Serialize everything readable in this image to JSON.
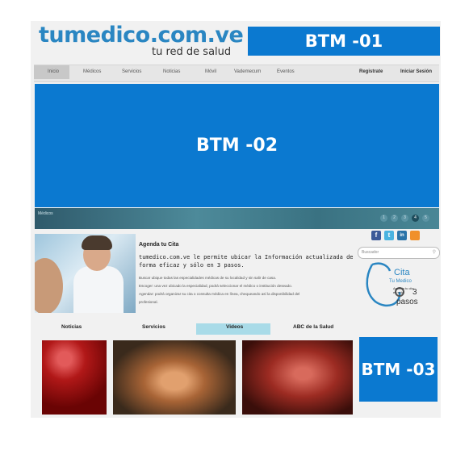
{
  "header": {
    "logo_main": "tumedico.com.ve",
    "logo_tagline": "tu red de salud",
    "banner_top": "BTM -01"
  },
  "nav": {
    "items": [
      "Inicio",
      "Médicos",
      "Servicios",
      "Noticias",
      "Móvil",
      "Vademecum",
      "Eventos"
    ],
    "register": "Registrate",
    "login": "Iniciar Sesión"
  },
  "hero": {
    "banner": "BTM -02",
    "caption": "Médicos",
    "pages": [
      "1",
      "2",
      "3",
      "4",
      "5"
    ],
    "current_page": "4"
  },
  "agenda": {
    "title": "Agenda tu Cita",
    "lead": "tumedico.com.ve le permite ubicar la Información actualizada de forma eficaz y sólo en 3 pasos.",
    "lines": [
      "Buscar ubique todas las especialidades médicas de su localidad y sin salir de casa.",
      "Escoger: una vez ubicado la especialidad, podrá seleccionar el médico o institución deseado.",
      "Agendar: podrá organizar su cita o consulta médica en línea, chequeando así la disponibilidad del",
      "profesional."
    ]
  },
  "sidebar": {
    "social": [
      "f",
      "t",
      "in",
      "rss"
    ],
    "search_placeholder": "Buscador",
    "cita": {
      "t1": "Cita",
      "t2": "Tu Medico",
      "t3": "Agenda tu cita",
      "t4": "en sólo",
      "num": "3",
      "t5": "pasos"
    },
    "banner_side": "BTM -03"
  },
  "tabs": [
    "Noticias",
    "Servicios",
    "Videos",
    "ABC de la Salud"
  ],
  "selected_tab": "Videos",
  "colors": {
    "brand_blue": "#0b79d0",
    "logo_blue": "#2a86c2",
    "tab_selected": "#a9dbe8"
  }
}
